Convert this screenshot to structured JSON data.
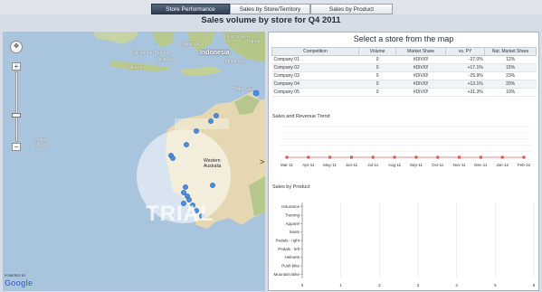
{
  "tabs": [
    {
      "label": "Store Performance",
      "active": true
    },
    {
      "label": "Sales by Store/Territory",
      "active": false
    },
    {
      "label": "Sales by Product",
      "active": false
    }
  ],
  "page_title": "Sales volume by store for Q4 2011",
  "map": {
    "labels": {
      "indonesia": "Indonesia",
      "java_sea": "Java Sea",
      "banda_sea": "Banda Sea",
      "timor_sea": "Timor Sea",
      "indian_ocean": "Indian\nOcean",
      "western_australia": "Western\nAustralia",
      "kalimantan": "Kalimantan\nTengah",
      "molucca": "Molucca\nSea",
      "makassar": "Makassar",
      "jakarta": "Jakarta",
      "papua": "Papua"
    },
    "watermark": "TRIAL",
    "attribution_small": "POWERED BY",
    "attribution": "Google",
    "zoom_in": "+",
    "zoom_out": "−",
    "pan_icon": "✥",
    "collapse_arrow": ">"
  },
  "panel": {
    "title": "Select a store from the map",
    "table": {
      "headers": [
        "Competition",
        "Volume",
        "Market Share",
        "vs. PY",
        "Nat. Market Share"
      ],
      "rows": [
        {
          "name": "Company 01",
          "volume": "0",
          "share": "#DIV/0!",
          "vs_py": "-27.0%",
          "nat": "12%"
        },
        {
          "name": "Company 02",
          "volume": "0",
          "share": "#DIV/0!",
          "vs_py": "+17.1%",
          "nat": "15%"
        },
        {
          "name": "Company 03",
          "volume": "0",
          "share": "#DIV/0!",
          "vs_py": "-25.9%",
          "nat": "23%"
        },
        {
          "name": "Company 04",
          "volume": "0",
          "share": "#DIV/0!",
          "vs_py": "+13.1%",
          "nat": "20%"
        },
        {
          "name": "Company 05",
          "volume": "0",
          "share": "#DIV/0!",
          "vs_py": "+31.3%",
          "nat": "10%"
        }
      ]
    },
    "trend_title": "Sales and Revenue Trend",
    "product_title": "Sales by Product"
  },
  "chart_data": [
    {
      "type": "line",
      "title": "Sales and Revenue Trend",
      "categories": [
        "Mar-11",
        "Apr-11",
        "May-11",
        "Jun-11",
        "Jul-11",
        "Aug-11",
        "Sep-11",
        "Oct-11",
        "Nov-11",
        "Dec-11",
        "Jan-12",
        "Feb-12"
      ],
      "series": [
        {
          "values": [
            0,
            0,
            0,
            0,
            0,
            0,
            0,
            0,
            0,
            0,
            0,
            0
          ]
        }
      ],
      "colors": {
        "line": "#e06a6a",
        "marker": "#d84c4c"
      }
    },
    {
      "type": "bar",
      "title": "Sales by Product",
      "orientation": "horizontal",
      "categories": [
        "Insurance",
        "Training",
        "Apparel",
        "Seats",
        "Pedals - right",
        "Pedals - left",
        "Helmets",
        "Push bike",
        "Mountain Bike"
      ],
      "values": [
        0,
        0,
        0,
        0,
        0,
        0,
        0,
        0,
        0
      ],
      "xlim": [
        0,
        6
      ],
      "xticks": [
        "0",
        "1",
        "2",
        "3",
        "4",
        "5",
        "6"
      ]
    }
  ]
}
